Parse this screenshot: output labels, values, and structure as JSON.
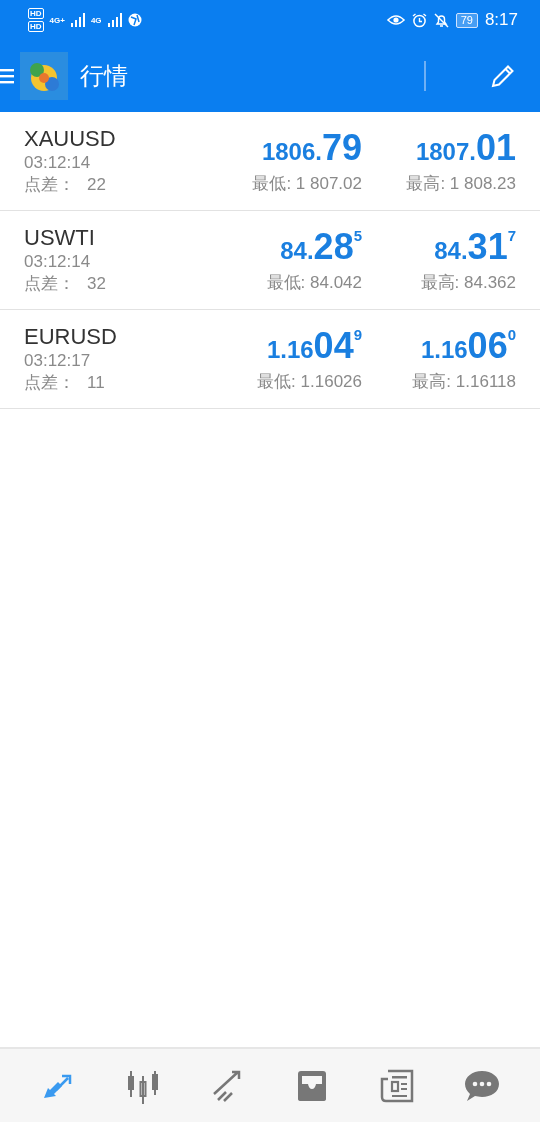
{
  "status_bar": {
    "sim_labels": [
      "HD",
      "HD"
    ],
    "networks": [
      "4G+",
      "4G"
    ],
    "battery": "79",
    "time": "8:17"
  },
  "header": {
    "title": "行情"
  },
  "quotes": [
    {
      "symbol": "XAUUSD",
      "time": "03:12:14",
      "spread_label": "点差：",
      "spread": "22",
      "bid": {
        "head": "1806.",
        "big": "79"
      },
      "ask": {
        "head": "1807.",
        "big": "01"
      },
      "low": "最低: 1 807.02",
      "high": "最高: 1 808.23"
    },
    {
      "symbol": "USWTI",
      "time": "03:12:14",
      "spread_label": "点差：",
      "spread": "32",
      "bid": {
        "head": "84.",
        "big": "28",
        "sup": "5"
      },
      "ask": {
        "head": "84.",
        "big": "31",
        "sup": "7"
      },
      "low": "最低: 84.042",
      "high": "最高: 84.362"
    },
    {
      "symbol": "EURUSD",
      "time": "03:12:17",
      "spread_label": "点差：",
      "spread": "11",
      "bid": {
        "head": "1.16",
        "big": "04",
        "sup": "9"
      },
      "ask": {
        "head": "1.16",
        "big": "06",
        "sup": "0"
      },
      "low": "最低: 1.16026",
      "high": "最高: 1.16118"
    }
  ],
  "nav": [
    {
      "kind": "quotes",
      "selected": true
    },
    {
      "kind": "chart",
      "selected": false
    },
    {
      "kind": "trade",
      "selected": false
    },
    {
      "kind": "inbox",
      "selected": false
    },
    {
      "kind": "news",
      "selected": false
    },
    {
      "kind": "chat",
      "selected": false
    }
  ]
}
